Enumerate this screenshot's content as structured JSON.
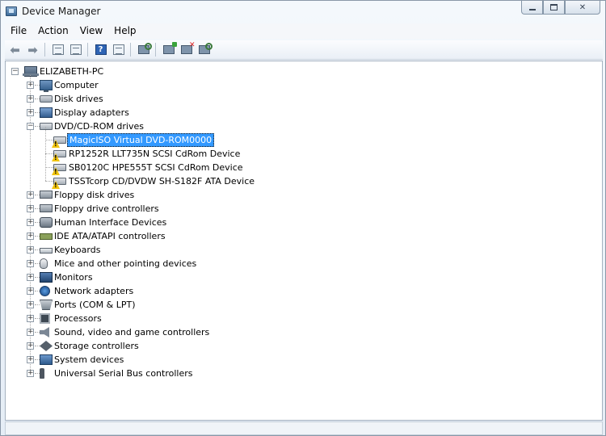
{
  "window": {
    "title": "Device Manager"
  },
  "caption_buttons": [
    "minimize",
    "maximize",
    "close"
  ],
  "menu": [
    "File",
    "Action",
    "View",
    "Help"
  ],
  "toolbar": [
    {
      "name": "back-button",
      "icon": "arrow-left-icon"
    },
    {
      "name": "forward-button",
      "icon": "arrow-right-icon"
    },
    {
      "name": "show-hide-console-tree-button",
      "icon": "console-tree-icon"
    },
    {
      "name": "properties-button",
      "icon": "properties-icon"
    },
    {
      "name": "help-button",
      "icon": "help-icon"
    },
    {
      "name": "view-list-button",
      "icon": "list-icon"
    },
    {
      "name": "scan-hardware-button",
      "icon": "scan-icon"
    },
    {
      "name": "update-driver-button",
      "icon": "update-driver-icon"
    },
    {
      "name": "uninstall-button",
      "icon": "uninstall-icon"
    },
    {
      "name": "disable-button",
      "icon": "disable-icon"
    }
  ],
  "tree": {
    "root": "ELIZABETH-PC",
    "categories": [
      {
        "label": "Computer",
        "icon": "computer-icon",
        "expanded": false
      },
      {
        "label": "Disk drives",
        "icon": "disk-drive-icon",
        "expanded": false
      },
      {
        "label": "Display adapters",
        "icon": "display-adapter-icon",
        "expanded": false
      },
      {
        "label": "DVD/CD-ROM drives",
        "icon": "dvd-drive-icon",
        "expanded": true,
        "children": [
          {
            "label": "MagicISO Virtual DVD-ROM0000",
            "selected": true,
            "warning": true
          },
          {
            "label": "RP1252R LLT735N SCSI CdRom Device",
            "warning": true
          },
          {
            "label": "SB0120C HPE555T SCSI CdRom Device",
            "warning": true
          },
          {
            "label": "TSSTcorp CD/DVDW SH-S182F ATA Device",
            "warning": true
          }
        ]
      },
      {
        "label": "Floppy disk drives",
        "icon": "floppy-disk-icon",
        "expanded": false
      },
      {
        "label": "Floppy drive controllers",
        "icon": "floppy-controller-icon",
        "expanded": false
      },
      {
        "label": "Human Interface Devices",
        "icon": "hid-icon",
        "expanded": false
      },
      {
        "label": "IDE ATA/ATAPI controllers",
        "icon": "ide-controller-icon",
        "expanded": false
      },
      {
        "label": "Keyboards",
        "icon": "keyboard-icon",
        "expanded": false
      },
      {
        "label": "Mice and other pointing devices",
        "icon": "mouse-icon",
        "expanded": false
      },
      {
        "label": "Monitors",
        "icon": "monitor-icon",
        "expanded": false
      },
      {
        "label": "Network adapters",
        "icon": "network-adapter-icon",
        "expanded": false
      },
      {
        "label": "Ports (COM & LPT)",
        "icon": "port-icon",
        "expanded": false
      },
      {
        "label": "Processors",
        "icon": "processor-icon",
        "expanded": false
      },
      {
        "label": "Sound, video and game controllers",
        "icon": "sound-icon",
        "expanded": false
      },
      {
        "label": "Storage controllers",
        "icon": "storage-controller-icon",
        "expanded": false
      },
      {
        "label": "System devices",
        "icon": "system-devices-icon",
        "expanded": false
      },
      {
        "label": "Universal Serial Bus controllers",
        "icon": "usb-icon",
        "expanded": false
      }
    ]
  },
  "colors": {
    "selection": "#3399ff",
    "warning": "#f1c40f"
  }
}
